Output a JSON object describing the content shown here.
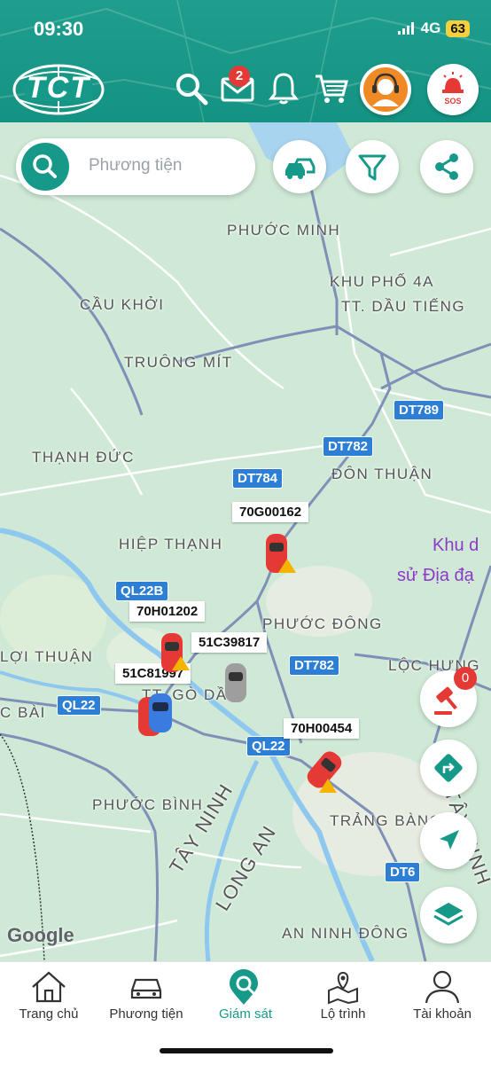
{
  "status_bar": {
    "time": "09:30",
    "network": "4G",
    "battery": "63"
  },
  "header": {
    "logo_text": "TCT",
    "mail_badge": "2",
    "sos_label": "SOS"
  },
  "search": {
    "placeholder": "Phương tiện"
  },
  "map": {
    "places": [
      "PHƯỚC MINH",
      "KHU PHỐ 4A",
      "CẦU KHỞI",
      "TT. DẦU TIẾNG",
      "TRUÔNG MÍT",
      "THẠNH ĐỨC",
      "ĐÔN THUẬN",
      "HIỆP THẠNH",
      "PHƯỚC ĐÔNG",
      "LỢI THUẬN",
      "LỘC HƯNG",
      "C BÀI",
      "TT. GÒ DẦU",
      "PHƯỚC BÌNH",
      "TRẢNG BÀNG",
      "TÂY NINH",
      "LONG AN",
      "AN NINH ĐÔNG",
      "TÂY NINH"
    ],
    "roads": [
      "DT789",
      "DT782",
      "DT784",
      "QL22B",
      "DT782",
      "QL22",
      "QL22",
      "DT6"
    ],
    "poi": [
      "Khu d",
      "sử Địa đạ"
    ],
    "google": "Google"
  },
  "vehicles": [
    "70G00162",
    "70H01202",
    "51C39817",
    "51C81997",
    "70H00454"
  ],
  "alert_badge": "0",
  "nav": [
    {
      "label": "Trang chủ",
      "icon": "home-icon"
    },
    {
      "label": "Phương tiện",
      "icon": "car-icon"
    },
    {
      "label": "Giám sát",
      "icon": "monitor-pin-icon"
    },
    {
      "label": "Lộ trình",
      "icon": "route-icon"
    },
    {
      "label": "Tài khoản",
      "icon": "user-icon"
    }
  ],
  "colors": {
    "primary": "#17998a",
    "alert": "#e53935",
    "road_shield": "#2d7fd5",
    "map_bg": "#cfe9d6"
  }
}
